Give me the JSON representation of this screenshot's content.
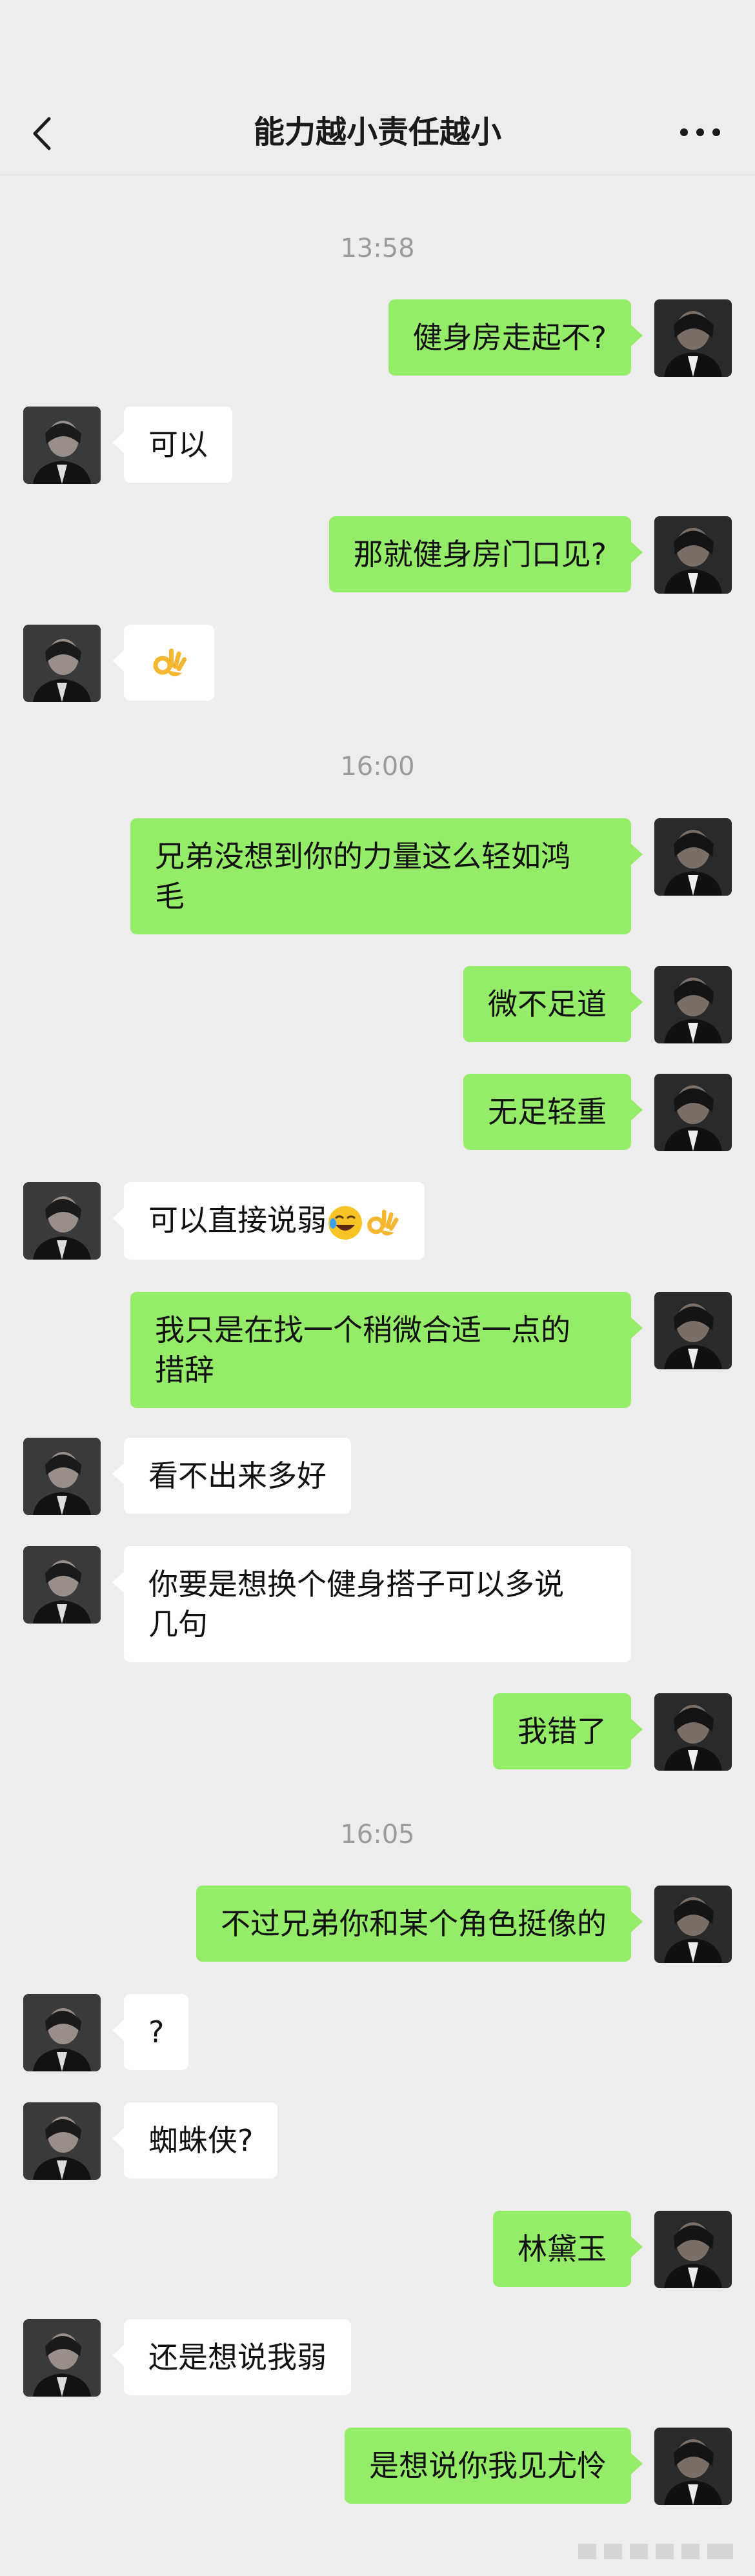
{
  "header": {
    "title": "能力越小责任越小"
  },
  "times": {
    "t1": "13:58",
    "t2": "16:00",
    "t3": "16:05"
  },
  "messages": {
    "m1": "健身房走起不?",
    "m2": "可以",
    "m3": "那就健身房门口见?",
    "m5_line1": "兄弟没想到你的力量这么轻如鸿",
    "m5_line2": "毛",
    "m6": "微不足道",
    "m7": "无足轻重",
    "m8": "可以直接说弱",
    "m9_line1": "我只是在找一个稍微合适一点的",
    "m9_line2": "措辞",
    "m10": "看不出来多好",
    "m11_line1": "你要是想换个健身搭子可以多说",
    "m11_line2": "几句",
    "m12": "我错了",
    "m13": "不过兄弟你和某个角色挺像的",
    "m14": "?",
    "m15": "蜘蛛侠?",
    "m16": "林黛玉",
    "m17": "还是想说我弱",
    "m18": "是想说你我见尤怜"
  },
  "icons": {
    "back": "chevron-left-icon",
    "more": "more-dots-icon",
    "ok_emoji": "ok-hand-emoji",
    "laugh_emoji": "rolling-laughing-emoji"
  },
  "colors": {
    "outgoing": "#95ec69",
    "incoming": "#ffffff",
    "background": "#ededed"
  }
}
